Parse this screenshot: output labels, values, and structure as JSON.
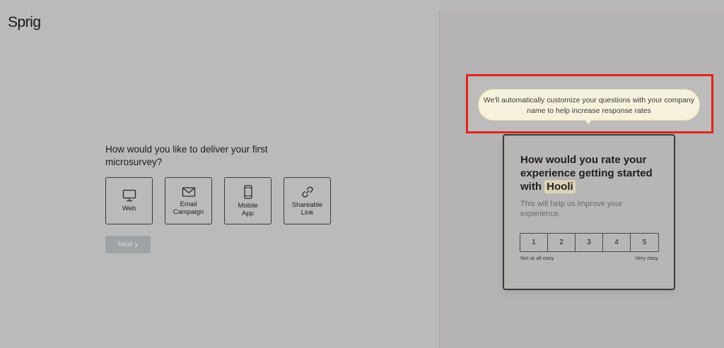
{
  "app": {
    "logo": "Sprig"
  },
  "delivery": {
    "question": "How would you like to deliver your first microsurvey?",
    "options": [
      {
        "label": "Web",
        "icon": "monitor-icon"
      },
      {
        "label": "Email\nCampaign",
        "icon": "envelope-icon"
      },
      {
        "label": "Mobile\nApp",
        "icon": "phone-icon"
      },
      {
        "label": "Shareable\nLink",
        "icon": "link-icon"
      }
    ],
    "next_label": "Next",
    "next_icon": "chevron-right-icon"
  },
  "tooltip": {
    "text": "We'll automatically customize your questions with your company name to help increase response rates"
  },
  "survey": {
    "title_before": "How would you rate your experience getting started with ",
    "company": "Hooli",
    "subtitle": "This will help us improve your experience.",
    "scale": [
      "1",
      "2",
      "3",
      "4",
      "5"
    ],
    "low_label": "Not at all easy",
    "high_label": "Very easy"
  },
  "colors": {
    "highlight_border": "#e0251b",
    "tooltip_bg": "#f6f1dc",
    "company_highlight": "#dcd3b6"
  }
}
